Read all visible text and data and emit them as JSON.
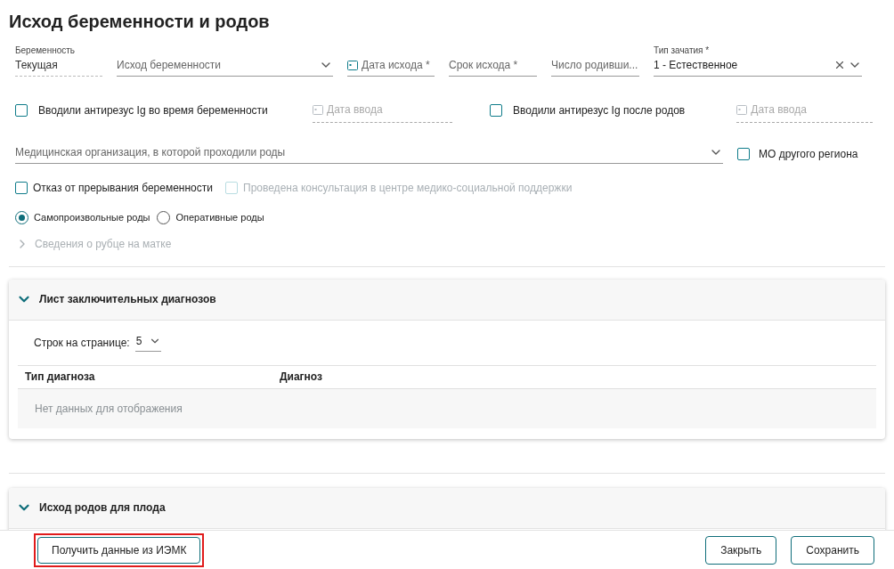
{
  "title": "Исход беременности и родов",
  "fields": [
    {
      "kind": "readonly",
      "label": "Беременность",
      "value": "Текущая"
    },
    {
      "kind": "select",
      "placeholder": "Исход беременности"
    },
    {
      "kind": "date",
      "placeholder": "Дата исхода *"
    },
    {
      "kind": "text",
      "placeholder": "Срок исхода *"
    },
    {
      "kind": "text",
      "placeholder": "Число родивши..."
    },
    {
      "kind": "select_clear",
      "label": "Тип зачатия *",
      "value": "1 - Естественное"
    }
  ],
  "antirhesus": [
    {
      "label": "Вводили антирезус Ig во время беременности",
      "checked": false,
      "date_placeholder": "Дата ввода"
    },
    {
      "label": "Вводили антирезус Ig после родов",
      "checked": false,
      "date_placeholder": "Дата ввода"
    }
  ],
  "organization": {
    "placeholder": "Медицинская организация, в которой проходили роды",
    "other_region": {
      "label": "МО другого региона",
      "checked": false
    }
  },
  "checks": [
    {
      "label": "Отказ от прерывания беременности",
      "checked": false,
      "disabled": false
    },
    {
      "label": "Проведена консультация в центре медико-социальной поддержки",
      "checked": false,
      "disabled": true
    }
  ],
  "delivery": [
    {
      "label": "Самопроизвольные роды",
      "selected": true
    },
    {
      "label": "Оперативные роды",
      "selected": false
    }
  ],
  "scar_section": {
    "label": "Сведения о рубце на матке",
    "expanded": false,
    "disabled": true
  },
  "diagnoses_card": {
    "title": "Лист заключительных диагнозов",
    "expanded": true,
    "page_size_label": "Строк на странице:",
    "page_size": "5",
    "columns": [
      "Тип диагноза",
      "Диагноз"
    ],
    "empty": "Нет данных для отображения"
  },
  "fetus_card": {
    "title": "Исход родов для плода",
    "expanded": true
  },
  "footer": {
    "fetch_button": {
      "label": "Получить данные из ИЭМК",
      "highlighted": true
    },
    "buttons": [
      "Закрыть",
      "Сохранить"
    ]
  }
}
